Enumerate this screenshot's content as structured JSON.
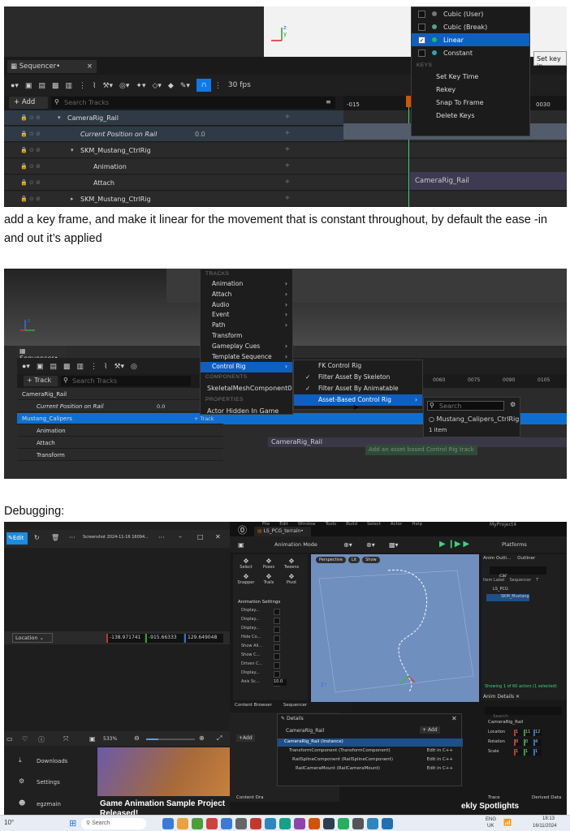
{
  "shot1": {
    "menu": {
      "items": [
        {
          "label": "Cubic (User)",
          "checked": false,
          "selected": false,
          "swatch": "#777777"
        },
        {
          "label": "Cubic (Break)",
          "checked": false,
          "selected": false,
          "swatch": "#5a9e8a"
        },
        {
          "label": "Linear",
          "checked": true,
          "selected": true,
          "swatch": "#22bb55"
        },
        {
          "label": "Constant",
          "checked": false,
          "selected": false,
          "swatch": "#2aa7a7"
        }
      ],
      "keys_header": "KEYS",
      "key_items": [
        "Set Key Time",
        "Rekey",
        "Snap To Frame",
        "Delete Keys"
      ],
      "tooltip": "Set key in"
    },
    "tab_label": "Sequencer",
    "tab_close": "×",
    "fps": "30 fps",
    "add_label": "+ Add",
    "search_placeholder": "Search Tracks",
    "ruler": {
      "left": "-015",
      "right": "0030"
    },
    "tracks": [
      {
        "label": "CameraRig_Rail",
        "indent": 0,
        "expanded": true,
        "value": "",
        "highlight": true
      },
      {
        "label": "Current Position on Rail",
        "indent": 1,
        "italic": true,
        "value": "0.0",
        "highlight": true
      },
      {
        "label": "SKM_Mustang_CtrlRig",
        "indent": 1,
        "expanded": true,
        "value": "",
        "highlight": false
      },
      {
        "label": "Animation",
        "indent": 2,
        "value": "",
        "highlight": false
      },
      {
        "label": "Attach",
        "indent": 2,
        "value": "",
        "highlight": false
      },
      {
        "label": "SKM_Mustang_CtrlRig",
        "indent": 1,
        "expanded": false,
        "value": "",
        "highlight": false
      }
    ],
    "timeline_clip": "CameraRig_Rail"
  },
  "caption1": "add a key frame, and make it linear for the movement that is constant throughout, by default the ease -in and out it’s applied",
  "shot2": {
    "tab_label": "Sequencer",
    "track_btn": "+ Track",
    "search_placeholder": "Search Tracks",
    "tracks_header": "TRACKS",
    "menu_items": [
      {
        "label": "Animation",
        "arrow": true
      },
      {
        "label": "Attach",
        "arrow": true
      },
      {
        "label": "Audio",
        "arrow": true
      },
      {
        "label": "Event",
        "arrow": true
      },
      {
        "label": "Path",
        "arrow": true
      },
      {
        "label": "Transform",
        "arrow": false
      },
      {
        "label": "Gameplay Cues",
        "arrow": true
      },
      {
        "label": "Template Sequence",
        "arrow": true
      },
      {
        "label": "Control Rig",
        "arrow": true,
        "selected": true
      }
    ],
    "components_header": "COMPONENTS",
    "component_item": "SkeletalMeshComponent0",
    "properties_header": "PROPERTIES",
    "property_item": "Actor Hidden In Game",
    "submenu": [
      {
        "label": "FK Control Rig",
        "check": false,
        "selected": false
      },
      {
        "label": "Filter Asset By Skeleton",
        "check": true,
        "selected": false
      },
      {
        "label": "Filter Asset By Animatable Controls",
        "check": true,
        "selected": false
      },
      {
        "label": "Asset-Based Control Rig",
        "check": false,
        "selected": true
      }
    ],
    "asset_search_placeholder": "Search",
    "asset_item": "Mustang_Calipers_CtrlRig",
    "asset_count": "1 item",
    "tracks": [
      {
        "label": "CameraRig_Rail",
        "value": ""
      },
      {
        "label": "Current Position on Rail",
        "value": "0.0"
      },
      {
        "label": "Mustang_Calipers",
        "value": "+ Track"
      },
      {
        "label": "Animation",
        "value": ""
      },
      {
        "label": "Attach",
        "value": ""
      },
      {
        "label": "Transform",
        "value": ""
      }
    ],
    "ruler": [
      "0060",
      "0075",
      "0090",
      "0105"
    ],
    "timeline_clip": "CameraRig_Rail",
    "tooltip": "Add an asset based Control Rig track"
  },
  "caption2": "Debugging:",
  "shot3": {
    "photos": {
      "edit_label": "Edit",
      "file_title": "Screenshot 2024-11-16 16094...",
      "location_label": "Location",
      "loc_x": "-138.971741",
      "loc_y": "-915.66333",
      "loc_z": "129.649048",
      "zoom": "533%",
      "downloads": "Downloads",
      "settings": "Settings",
      "user": "egzmain",
      "news_title": "Game Animation Sample Project Released!"
    },
    "ue": {
      "project": "MyProject4",
      "level_tab": "LS_PCG_terrain",
      "menu_items": [
        "File",
        "Edit",
        "Window",
        "Tools",
        "Build",
        "Select",
        "Actor",
        "Help"
      ],
      "mode": "Animation Mode",
      "platforms": "Platforms",
      "viewport_btns": [
        "Perspective",
        "Lit",
        "Show"
      ],
      "anim_tools": [
        "Select",
        "Poses",
        "Tweens",
        "Snapper",
        "Trails",
        "Pivot"
      ],
      "anim_settings_header": "Animation Settings",
      "anim_settings": [
        "Display...",
        "Display...",
        "Display...",
        "Hide Co...",
        "Show All...",
        "Show C...",
        "Driven C...",
        "Display...",
        "Axis Sc..."
      ],
      "axis_scale": "10.0",
      "outliner_tabs": [
        "Anim Outli...",
        "Outliner"
      ],
      "outliner_filter": "car",
      "outliner_cols": [
        "Item Label",
        "Sequencer",
        "T"
      ],
      "outliner_items": [
        "LS_PCG",
        "SKM_Mustang"
      ],
      "outliner_status": "Showing 1 of 60 actors (1 selected)",
      "anim_details": "Anim Details",
      "details_search": "Search",
      "details_obj": "CameraRig_Rail",
      "details_rows": [
        {
          "label": "Location",
          "v": [
            "1",
            "11",
            "12"
          ]
        },
        {
          "label": "Rotation",
          "v": [
            "0",
            "0",
            "4"
          ]
        },
        {
          "label": "Scale",
          "v": [
            "1",
            "1",
            "1"
          ]
        }
      ],
      "bottom_tabs": [
        "Content Browser",
        "Sequencer"
      ],
      "details_win": {
        "title": "Details",
        "object": "CameraRig_Rail",
        "add": "+ Add",
        "root": "CameraRig_Rail (Instance)",
        "components": [
          {
            "label": "TransformComponent (TransformComponent)",
            "link": "Edit in C++"
          },
          {
            "label": "RailSplineComponent (RailSplineComponent)",
            "link": "Edit in C++"
          },
          {
            "label": "RailCameraMount (RailCameraMount)",
            "link": "Edit in C++"
          }
        ]
      },
      "content_drawer": "Content Dra",
      "trace": "Trace",
      "derived": "Derived Data",
      "spotlight": "ekly Spotlights"
    },
    "taskbar": {
      "search": "Search",
      "weather": "10°",
      "lang": "ENG",
      "region": "UK",
      "time": "18:13",
      "date": "16/11/2024"
    }
  },
  "colors": {
    "ue_bg": "#242424",
    "select": "#0e5fc0",
    "accent": "#1c8ce0"
  }
}
